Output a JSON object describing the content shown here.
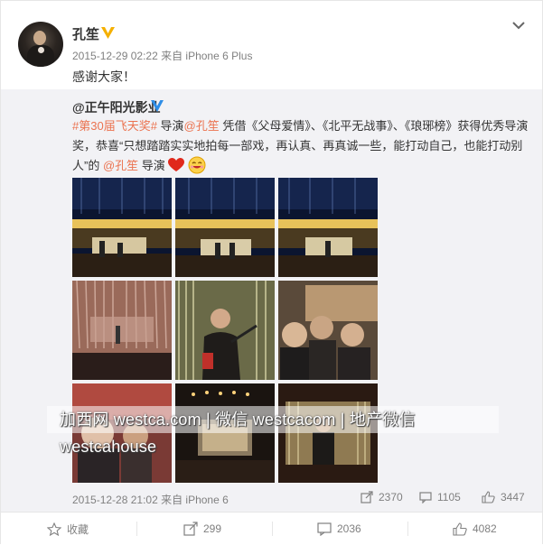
{
  "post": {
    "author": "孔笙",
    "meta": "2015-12-29 02:22 来自 iPhone 6 Plus",
    "text": "感谢大家！"
  },
  "repost": {
    "author": "@正午阳光影业",
    "hashtag": "#第30届飞天奖#",
    "t1": " 导演",
    "mention1": "@孔笙",
    "t2": " 凭借《父母爱情》、《北平无战事》、《琅琊榜》获得优秀导演奖，恭喜“只想踏踏实实地拍每一部戏，再认真、再真诚一些，能打动自己，也能打动别人”的 ",
    "mention2": "@孔笙",
    "t3": " 导演",
    "meta": "2015-12-28 21:02 来自 iPhone 6",
    "stats": {
      "forward": "2370",
      "comment": "1105",
      "like": "3447"
    },
    "watermark": "加西网 westca.com | 微信 westcacom | 地产微信 westcahouse"
  },
  "footer": {
    "favorite": "收藏",
    "forward": "299",
    "comment": "2036",
    "like": "4082"
  },
  "icons": {
    "verified": "verified-badge-icon",
    "caret": "chevron-down-icon",
    "star": "star-icon",
    "forward": "forward-icon",
    "comment": "comment-icon",
    "like": "thumbs-up-icon"
  },
  "colors": {
    "link": "#eb7350",
    "badge": "#f5b000",
    "verified_blue": "#2e8de6"
  }
}
